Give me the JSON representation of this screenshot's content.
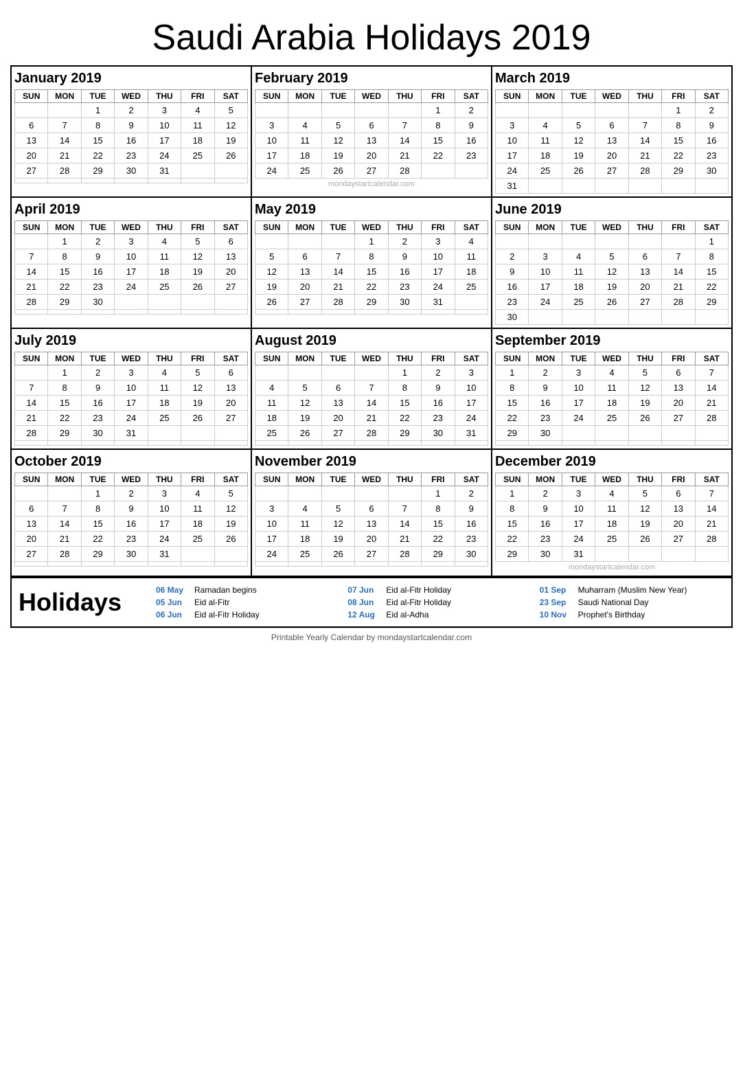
{
  "title": "Saudi Arabia Holidays 2019",
  "months": [
    {
      "name": "January 2019",
      "days_header": [
        "SUN",
        "MON",
        "TUE",
        "WED",
        "THU",
        "FRI",
        "SAT"
      ],
      "weeks": [
        [
          "",
          "",
          "1",
          "2",
          "3",
          "4",
          "5"
        ],
        [
          "6",
          "7",
          "8",
          "9",
          "10",
          "11",
          "12"
        ],
        [
          "13",
          "14",
          "15",
          "16",
          "17",
          "18",
          "19"
        ],
        [
          "20",
          "21",
          "22",
          "23",
          "24",
          "25",
          "26"
        ],
        [
          "27",
          "28",
          "29",
          "30",
          "31",
          "",
          ""
        ],
        [
          "",
          "",
          "",
          "",
          "",
          "",
          ""
        ]
      ],
      "watermark": ""
    },
    {
      "name": "February 2019",
      "days_header": [
        "SUN",
        "MON",
        "TUE",
        "WED",
        "THU",
        "FRI",
        "SAT"
      ],
      "weeks": [
        [
          "",
          "",
          "",
          "",
          "",
          "1",
          "2"
        ],
        [
          "3",
          "4",
          "5",
          "6",
          "7",
          "8",
          "9"
        ],
        [
          "10",
          "11",
          "12",
          "13",
          "14",
          "15",
          "16"
        ],
        [
          "17",
          "18",
          "19",
          "20",
          "21",
          "22",
          "23"
        ],
        [
          "24",
          "25",
          "26",
          "27",
          "28",
          "",
          ""
        ],
        [
          "",
          "",
          "",
          "",
          "",
          "",
          ""
        ]
      ],
      "watermark": "mondaystartcalendar.com"
    },
    {
      "name": "March 2019",
      "days_header": [
        "SUN",
        "MON",
        "TUE",
        "WED",
        "THU",
        "FRI",
        "SAT"
      ],
      "weeks": [
        [
          "",
          "",
          "",
          "",
          "",
          "1",
          "2"
        ],
        [
          "3",
          "4",
          "5",
          "6",
          "7",
          "8",
          "9"
        ],
        [
          "10",
          "11",
          "12",
          "13",
          "14",
          "15",
          "16"
        ],
        [
          "17",
          "18",
          "19",
          "20",
          "21",
          "22",
          "23"
        ],
        [
          "24",
          "25",
          "26",
          "27",
          "28",
          "29",
          "30"
        ],
        [
          "31",
          "",
          "",
          "",
          "",
          "",
          ""
        ]
      ],
      "watermark": ""
    },
    {
      "name": "April 2019",
      "days_header": [
        "SUN",
        "MON",
        "TUE",
        "WED",
        "THU",
        "FRI",
        "SAT"
      ],
      "weeks": [
        [
          "",
          "1",
          "2",
          "3",
          "4",
          "5",
          "6"
        ],
        [
          "7",
          "8",
          "9",
          "10",
          "11",
          "12",
          "13"
        ],
        [
          "14",
          "15",
          "16",
          "17",
          "18",
          "19",
          "20"
        ],
        [
          "21",
          "22",
          "23",
          "24",
          "25",
          "26",
          "27"
        ],
        [
          "28",
          "29",
          "30",
          "",
          "",
          "",
          ""
        ],
        [
          "",
          "",
          "",
          "",
          "",
          "",
          ""
        ]
      ],
      "watermark": ""
    },
    {
      "name": "May 2019",
      "days_header": [
        "SUN",
        "MON",
        "TUE",
        "WED",
        "THU",
        "FRI",
        "SAT"
      ],
      "weeks": [
        [
          "",
          "",
          "",
          "1",
          "2",
          "3",
          "4"
        ],
        [
          "5",
          "6",
          "7",
          "8",
          "9",
          "10",
          "11"
        ],
        [
          "12",
          "13",
          "14",
          "15",
          "16",
          "17",
          "18"
        ],
        [
          "19",
          "20",
          "21",
          "22",
          "23",
          "24",
          "25"
        ],
        [
          "26",
          "27",
          "28",
          "29",
          "30",
          "31",
          ""
        ],
        [
          "",
          "",
          "",
          "",
          "",
          "",
          ""
        ]
      ],
      "watermark": ""
    },
    {
      "name": "June 2019",
      "days_header": [
        "SUN",
        "MON",
        "TUE",
        "WED",
        "THU",
        "FRI",
        "SAT"
      ],
      "weeks": [
        [
          "",
          "",
          "",
          "",
          "",
          "",
          "1"
        ],
        [
          "2",
          "3",
          "4",
          "5",
          "6",
          "7",
          "8"
        ],
        [
          "9",
          "10",
          "11",
          "12",
          "13",
          "14",
          "15"
        ],
        [
          "16",
          "17",
          "18",
          "19",
          "20",
          "21",
          "22"
        ],
        [
          "23",
          "24",
          "25",
          "26",
          "27",
          "28",
          "29"
        ],
        [
          "30",
          "",
          "",
          "",
          "",
          "",
          ""
        ]
      ],
      "watermark": ""
    },
    {
      "name": "July 2019",
      "days_header": [
        "SUN",
        "MON",
        "TUE",
        "WED",
        "THU",
        "FRI",
        "SAT"
      ],
      "weeks": [
        [
          "",
          "1",
          "2",
          "3",
          "4",
          "5",
          "6"
        ],
        [
          "7",
          "8",
          "9",
          "10",
          "11",
          "12",
          "13"
        ],
        [
          "14",
          "15",
          "16",
          "17",
          "18",
          "19",
          "20"
        ],
        [
          "21",
          "22",
          "23",
          "24",
          "25",
          "26",
          "27"
        ],
        [
          "28",
          "29",
          "30",
          "31",
          "",
          "",
          ""
        ],
        [
          "",
          "",
          "",
          "",
          "",
          "",
          ""
        ]
      ],
      "watermark": ""
    },
    {
      "name": "August 2019",
      "days_header": [
        "SUN",
        "MON",
        "TUE",
        "WED",
        "THU",
        "FRI",
        "SAT"
      ],
      "weeks": [
        [
          "",
          "",
          "",
          "",
          "1",
          "2",
          "3"
        ],
        [
          "4",
          "5",
          "6",
          "7",
          "8",
          "9",
          "10"
        ],
        [
          "11",
          "12",
          "13",
          "14",
          "15",
          "16",
          "17"
        ],
        [
          "18",
          "19",
          "20",
          "21",
          "22",
          "23",
          "24"
        ],
        [
          "25",
          "26",
          "27",
          "28",
          "29",
          "30",
          "31"
        ],
        [
          "",
          "",
          "",
          "",
          "",
          "",
          ""
        ]
      ],
      "watermark": ""
    },
    {
      "name": "September 2019",
      "days_header": [
        "SUN",
        "MON",
        "TUE",
        "WED",
        "THU",
        "FRI",
        "SAT"
      ],
      "weeks": [
        [
          "1",
          "2",
          "3",
          "4",
          "5",
          "6",
          "7"
        ],
        [
          "8",
          "9",
          "10",
          "11",
          "12",
          "13",
          "14"
        ],
        [
          "15",
          "16",
          "17",
          "18",
          "19",
          "20",
          "21"
        ],
        [
          "22",
          "23",
          "24",
          "25",
          "26",
          "27",
          "28"
        ],
        [
          "29",
          "30",
          "",
          "",
          "",
          "",
          ""
        ],
        [
          "",
          "",
          "",
          "",
          "",
          "",
          ""
        ]
      ],
      "watermark": ""
    },
    {
      "name": "October 2019",
      "days_header": [
        "SUN",
        "MON",
        "TUE",
        "WED",
        "THU",
        "FRI",
        "SAT"
      ],
      "weeks": [
        [
          "",
          "",
          "1",
          "2",
          "3",
          "4",
          "5"
        ],
        [
          "6",
          "7",
          "8",
          "9",
          "10",
          "11",
          "12"
        ],
        [
          "13",
          "14",
          "15",
          "16",
          "17",
          "18",
          "19"
        ],
        [
          "20",
          "21",
          "22",
          "23",
          "24",
          "25",
          "26"
        ],
        [
          "27",
          "28",
          "29",
          "30",
          "31",
          "",
          ""
        ],
        [
          "",
          "",
          "",
          "",
          "",
          "",
          ""
        ]
      ],
      "watermark": ""
    },
    {
      "name": "November 2019",
      "days_header": [
        "SUN",
        "MON",
        "TUE",
        "WED",
        "THU",
        "FRI",
        "SAT"
      ],
      "weeks": [
        [
          "",
          "",
          "",
          "",
          "",
          "1",
          "2"
        ],
        [
          "3",
          "4",
          "5",
          "6",
          "7",
          "8",
          "9"
        ],
        [
          "10",
          "11",
          "12",
          "13",
          "14",
          "15",
          "16"
        ],
        [
          "17",
          "18",
          "19",
          "20",
          "21",
          "22",
          "23"
        ],
        [
          "24",
          "25",
          "26",
          "27",
          "28",
          "29",
          "30"
        ],
        [
          "",
          "",
          "",
          "",
          "",
          "",
          ""
        ]
      ],
      "watermark": ""
    },
    {
      "name": "December 2019",
      "days_header": [
        "SUN",
        "MON",
        "TUE",
        "WED",
        "THU",
        "FRI",
        "SAT"
      ],
      "weeks": [
        [
          "1",
          "2",
          "3",
          "4",
          "5",
          "6",
          "7"
        ],
        [
          "8",
          "9",
          "10",
          "11",
          "12",
          "13",
          "14"
        ],
        [
          "15",
          "16",
          "17",
          "18",
          "19",
          "20",
          "21"
        ],
        [
          "22",
          "23",
          "24",
          "25",
          "26",
          "27",
          "28"
        ],
        [
          "29",
          "30",
          "31",
          "",
          "",
          "",
          ""
        ],
        [
          "",
          "",
          "",
          "",
          "",
          "",
          ""
        ]
      ],
      "watermark": "mondaystartcalendar.com"
    }
  ],
  "holidays_title": "Holidays",
  "holidays": [
    {
      "date": "06 May",
      "name": "Ramadan begins"
    },
    {
      "date": "07 Jun",
      "name": "Eid al-Fitr Holiday"
    },
    {
      "date": "01 Sep",
      "name": "Muharram (Muslim New Year)"
    },
    {
      "date": "05 Jun",
      "name": "Eid al-Fitr"
    },
    {
      "date": "08 Jun",
      "name": "Eid al-Fitr Holiday"
    },
    {
      "date": "23 Sep",
      "name": "Saudi National Day"
    },
    {
      "date": "06 Jun",
      "name": "Eid al-Fitr Holiday"
    },
    {
      "date": "12 Aug",
      "name": "Eid al-Adha"
    },
    {
      "date": "10 Nov",
      "name": "Prophet's Birthday"
    }
  ],
  "footer": "Printable Yearly Calendar by mondaystartcalendar.com"
}
